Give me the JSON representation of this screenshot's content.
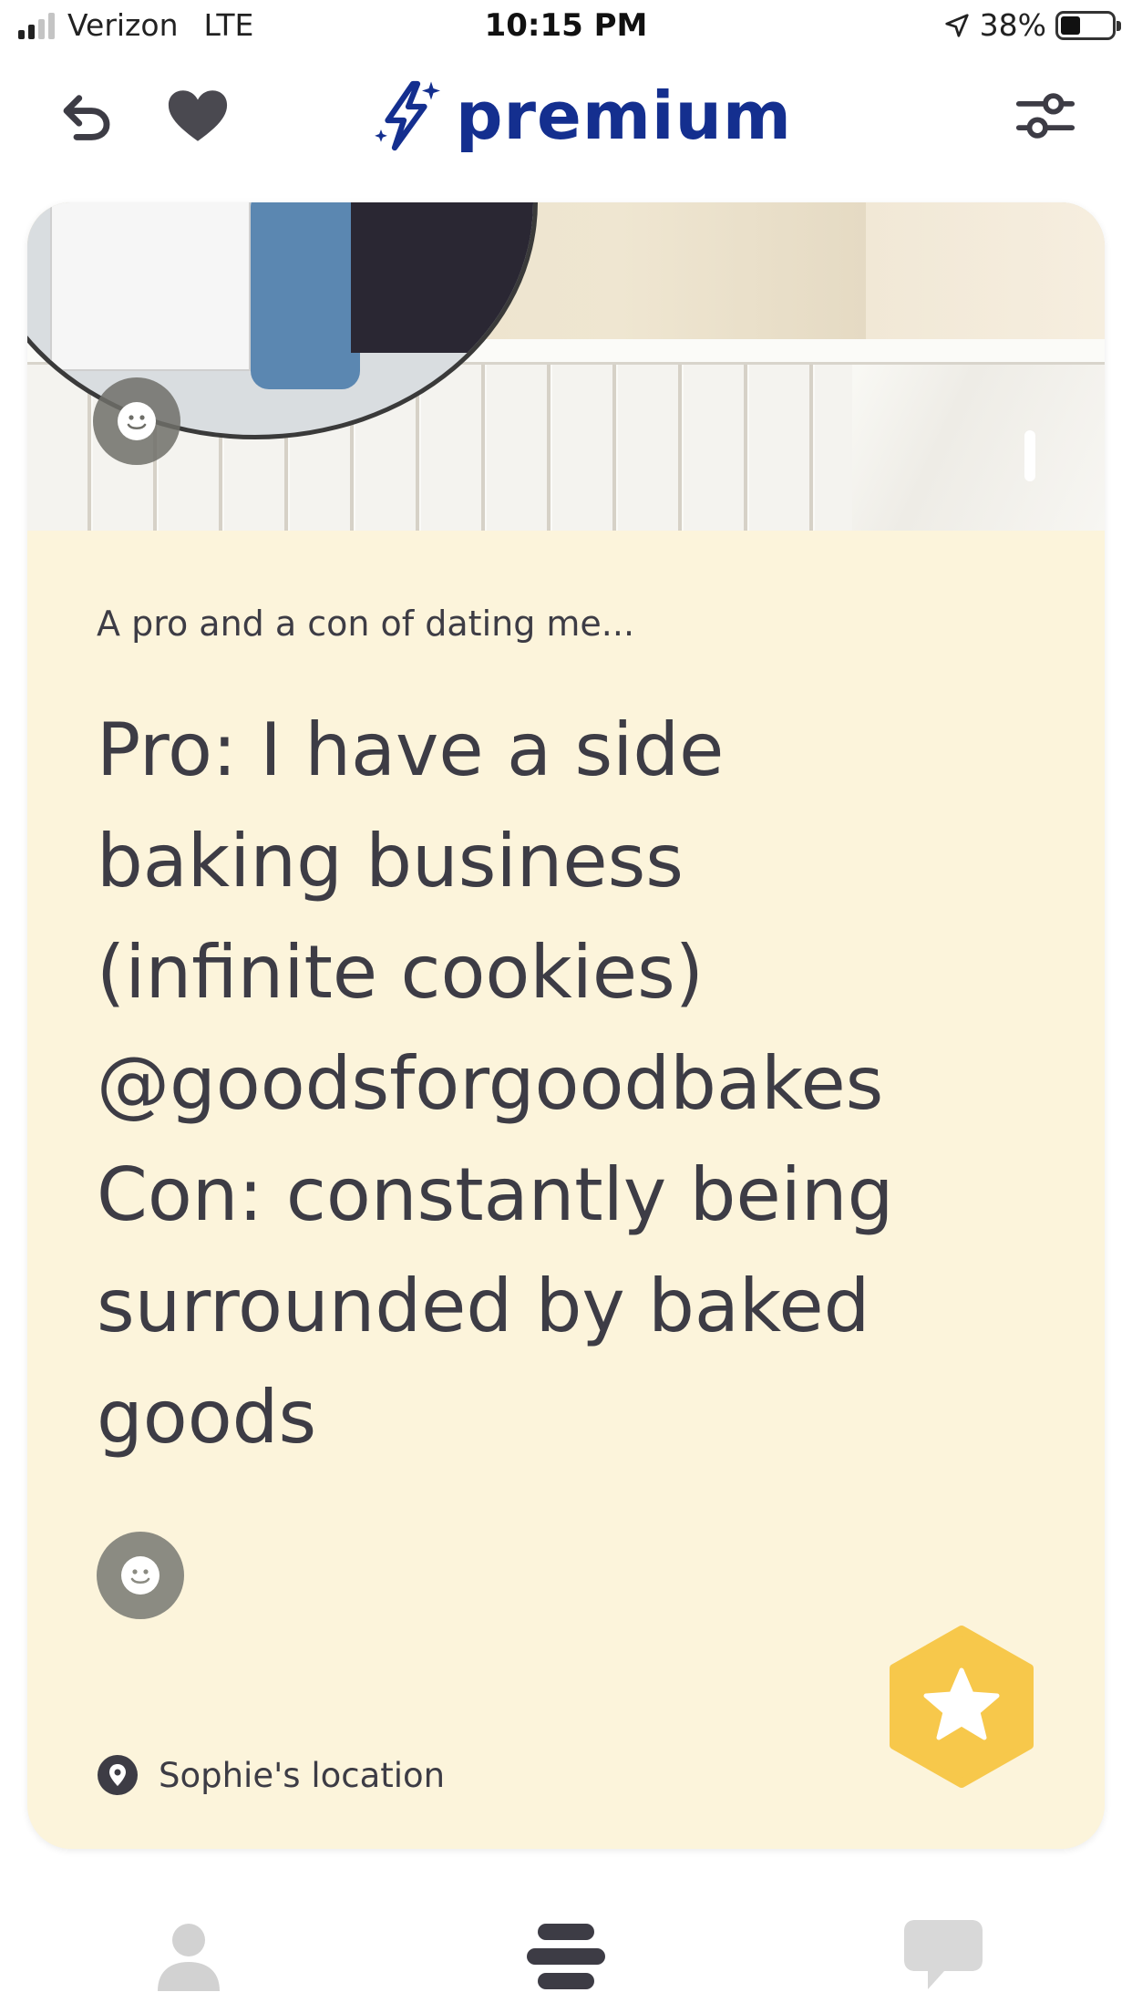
{
  "status_bar": {
    "carrier": "Verizon",
    "network": "LTE",
    "time": "10:15 PM",
    "battery": "38%",
    "battery_level": 0.38
  },
  "header": {
    "brand": "premium",
    "icons": {
      "undo": "undo-icon",
      "like": "heart-icon",
      "brand": "lightning-sparkle-icon",
      "filters": "filter-sliders-icon"
    },
    "brand_color": "#142f8f"
  },
  "card": {
    "background": "#fcf4db",
    "prompt_question": "A pro and a con of dating me...",
    "prompt_answer": "Pro: I have a side\nbaking business\n(infinite cookies)\n@goodsforgoodbakes\nCon: constantly being\nsurrounded by baked\ngoods",
    "location": "Sophie's location",
    "superlike_color": "#f7c84b"
  },
  "bottom_nav": {
    "items": [
      {
        "icon": "profile-icon"
      },
      {
        "icon": "discover-icon"
      },
      {
        "icon": "chat-icon"
      }
    ]
  }
}
